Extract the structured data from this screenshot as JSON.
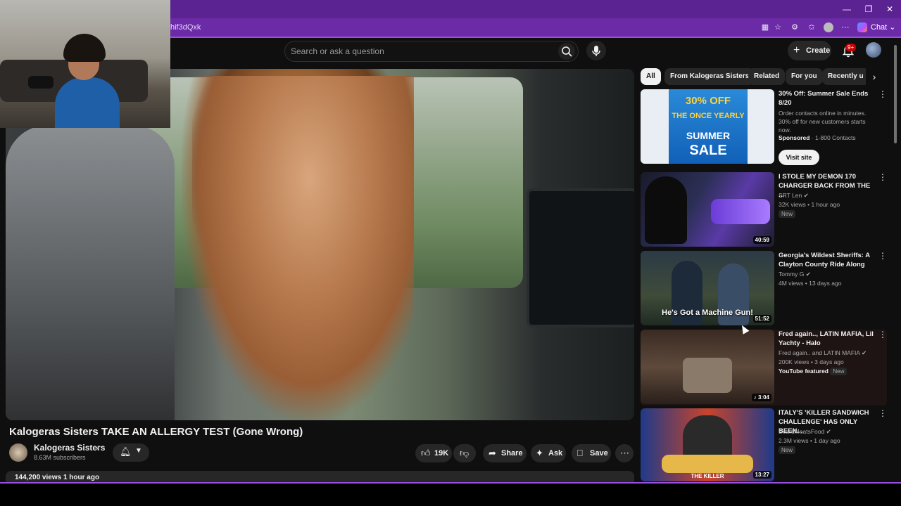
{
  "browser": {
    "url_fragment": "hif3dQxk",
    "chat_label": "Chat",
    "window_controls": [
      "—",
      "❐",
      "✕"
    ]
  },
  "youtube": {
    "search_placeholder": "Search or ask a question",
    "create_label": "Create",
    "notifications_badge": "9+"
  },
  "video": {
    "title": "Kalogeras Sisters TAKE AN ALLERGY TEST (Gone Wrong)",
    "channel_name": "Kalogeras Sisters",
    "subscribers": "8.63M subscribers",
    "likes": "19K",
    "share_label": "Share",
    "ask_label": "Ask",
    "save_label": "Save",
    "views_line": "144,200 views  1 hour ago"
  },
  "chips": [
    "All",
    "From Kalogeras Sisters",
    "Related",
    "For you",
    "Recently u"
  ],
  "recommendations": [
    {
      "type": "ad",
      "title": "30% Off: Summer Sale Ends 8/20",
      "desc": "Order contacts online in minutes. 30% off for new customers starts now.",
      "sponsor": "Sponsored",
      "advertiser": "1-800 Contacts",
      "cta": "Visit site",
      "thumb_text_1": "30% OFF",
      "thumb_text_2": "THE ONCE YEARLY",
      "thumb_text_3": "SUMMER",
      "thumb_text_4": "SALE"
    },
    {
      "title": "I STOLE MY DEMON 170 CHARGER BACK FROM THE ...",
      "channel": "SRT Len",
      "meta": "32K views • 1 hour ago",
      "badge": "New",
      "duration": "40:59"
    },
    {
      "title": "Georgia's Wildest Sheriffs: A Clayton County Ride Along",
      "channel": "Tommy G",
      "meta": "4M views • 13 days ago",
      "duration": "51:52",
      "thumb_caption": "He's Got a Machine Gun!"
    },
    {
      "title": "Fred again.., LATIN MAFIA, Lil Yachty - Halo",
      "channel": "Fred again.. and LATIN MAFIA",
      "meta": "200K views • 3 days ago",
      "featured": "YouTube featured",
      "badge": "New",
      "duration": "3:04"
    },
    {
      "title": "ITALY'S 'KILLER SANDWICH CHALLENGE' HAS ONLY BEEN...",
      "channel": "BeardMeatsFood",
      "meta": "2.3M views • 1 day ago",
      "badge": "New",
      "duration": "13:27",
      "thumb_caption": "THE KILLER"
    }
  ]
}
